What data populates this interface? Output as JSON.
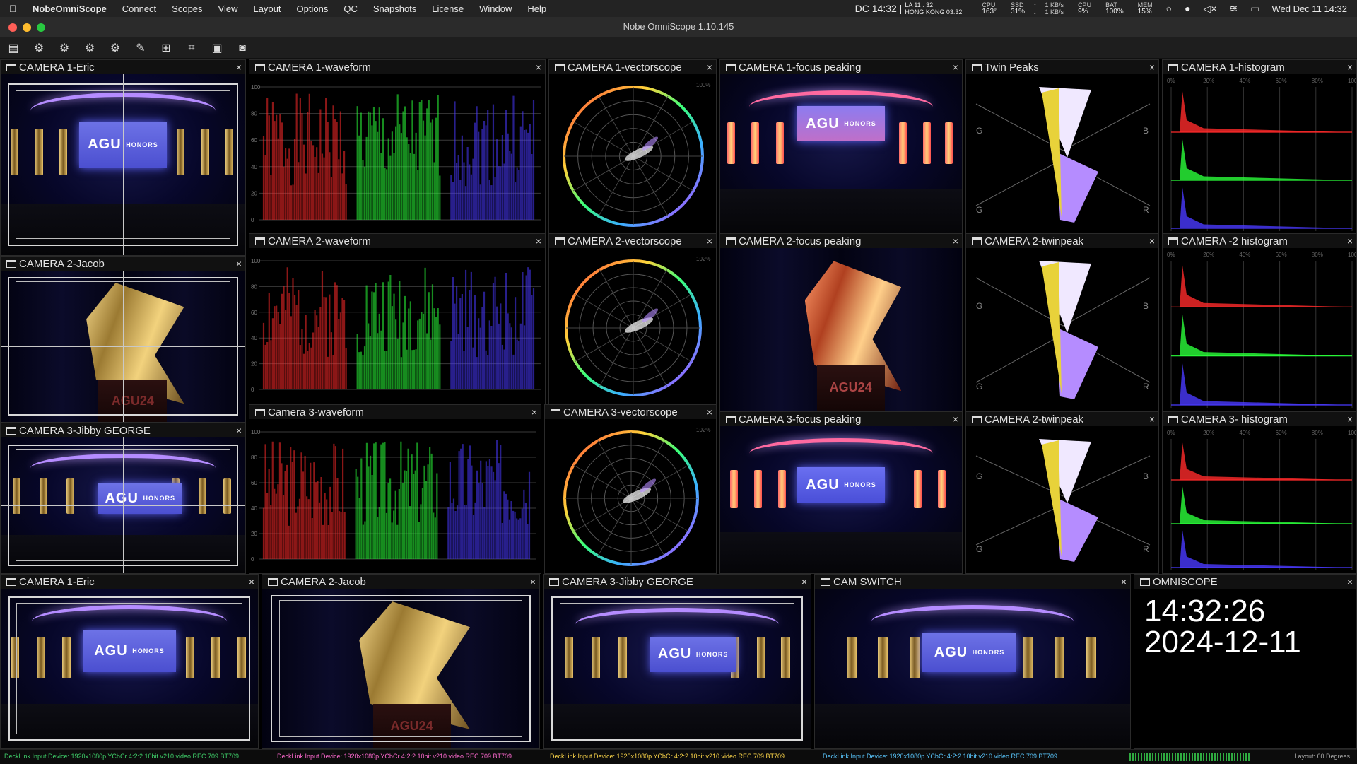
{
  "menubar": {
    "items": [
      "NobeOmniScope",
      "Connect",
      "Scopes",
      "View",
      "Layout",
      "Options",
      "QC",
      "Snapshots",
      "License",
      "Window",
      "Help"
    ],
    "clock": "DC 14:32 |",
    "tz_la": "LA 11 : 32",
    "tz_hk": "HONG KONG 03:32",
    "cpu_temp_label": "CPU",
    "cpu_temp_value": "163°",
    "ssd_label": "SSD",
    "ssd_value": "31%",
    "net_up": "1 KB/s",
    "net_down": "1 KB/s",
    "cpu_label": "CPU",
    "cpu_value": "9%",
    "bat_label": "BAT",
    "bat_value": "100%",
    "mem_label": "MEM",
    "mem_value": "15%",
    "date_time": "Wed Dec 11  14:32"
  },
  "window": {
    "title": "Nobe OmniScope 1.10.145"
  },
  "toolbar": {
    "icons": [
      "layout-icon",
      "scope-settings-icon-1",
      "scope-settings-icon-2",
      "scope-settings-icon-3",
      "scope-settings-icon-4",
      "wrench-icon",
      "network-icon",
      "crop-icon",
      "gallery-icon",
      "camera-icon"
    ]
  },
  "panels": {
    "cam1_eric": "CAMERA 1-Eric",
    "cam1_waveform": "CAMERA 1-waveform",
    "cam1_vectorscope": "CAMERA 1-vectorscope",
    "cam1_focus": "CAMERA 1-focus peaking",
    "twin_peaks": "Twin Peaks",
    "cam1_histogram": "CAMERA 1-histogram",
    "cam2_jacob": "CAMERA 2-Jacob",
    "cam2_waveform": "CAMERA 2-waveform",
    "cam2_vectorscope": "CAMERA 2-vectorscope",
    "cam2_focus": "CAMERA 2-focus peaking",
    "cam2_twinpeak_a": "CAMERA 2-twinpeak",
    "cam2_histogram": "CAMERA -2 histogram",
    "cam3_jibby": "CAMERA 3-Jibby GEORGE",
    "cam3_waveform": "Camera 3-waveform",
    "cam3_vectorscope": "CAMERA 3-vectorscope",
    "cam3_focus": "CAMERA 3-focus peaking",
    "cam2_twinpeak_b": "CAMERA 2-twinpeak",
    "cam3_histogram": "CAMERA 3- histogram",
    "b_cam1_eric": "CAMERA 1-Eric",
    "b_cam2_jacob": "CAMERA 2-Jacob",
    "b_cam3_jibby": "CAMERA 3-Jibby GEORGE",
    "cam_switch": "CAM SWITCH",
    "omniscope": "OMNISCOPE"
  },
  "close_glyph": "×",
  "scene_text": {
    "agu": "AGU",
    "honors": "HONORS",
    "podium": "AGU24"
  },
  "waveform_scale": [
    "100",
    "80",
    "60",
    "40",
    "20",
    "0"
  ],
  "histogram_scale": [
    "0%",
    "20%",
    "40%",
    "60%",
    "80%",
    "100%"
  ],
  "vectorscope_max": {
    "cam1": "100%",
    "cam2": "102%",
    "cam3": "102%"
  },
  "twinpeak_labels": {
    "g": "G",
    "b": "B",
    "r": "R"
  },
  "omniscope_clock": {
    "time": "14:32:26",
    "date": "2024-12-11"
  },
  "statusbar": {
    "device_info": "DeckLink Input Device: 1920x1080p YCbCr 4:2:2 10bit v210 video REC.709 BT709",
    "layout": "Layout: 60 Degrees",
    "colors": [
      "#3fd06a",
      "#ff6ad0",
      "#ffd84a",
      "#5ac8ff"
    ]
  },
  "colors": {
    "red": "#ff2a2a",
    "green": "#2aff3a",
    "blue": "#4a3aff",
    "accent": "#b58cff"
  }
}
